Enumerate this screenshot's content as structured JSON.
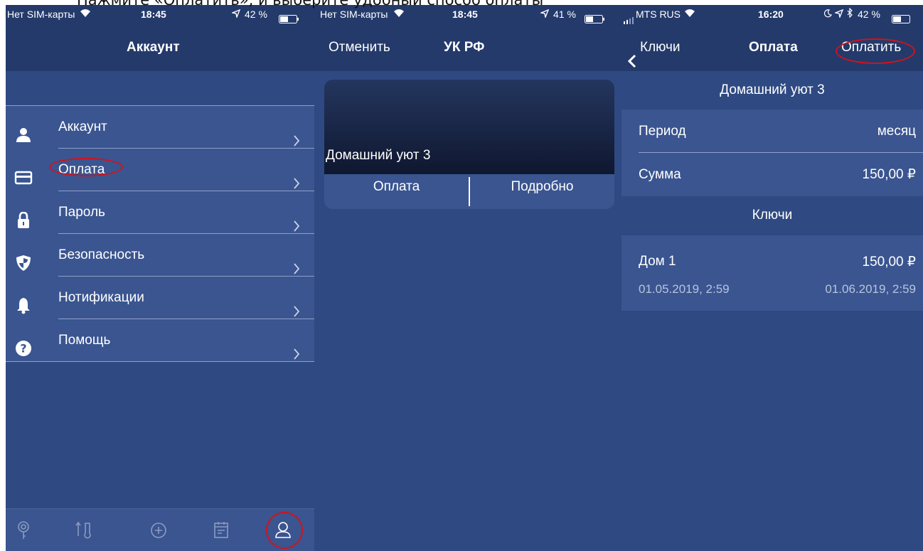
{
  "caption": "Нажмите «Оплатить», и выберите удобный способ оплаты",
  "left_screen": {
    "status": {
      "carrier": "Нет SIM-карты",
      "time": "18:45",
      "battery": "42 %"
    },
    "nav_title": "Аккаунт",
    "menu": [
      {
        "label": "Аккаунт",
        "icon": "person-icon"
      },
      {
        "label": "Оплата",
        "icon": "card-icon"
      },
      {
        "label": "Пароль",
        "icon": "lock-icon"
      },
      {
        "label": "Безопасность",
        "icon": "shield-icon"
      },
      {
        "label": "Нотификации",
        "icon": "bell-icon"
      },
      {
        "label": "Помощь",
        "icon": "help-icon"
      }
    ],
    "tabs": [
      "key-icon",
      "thermometer-icon",
      "add-icon",
      "calendar-icon",
      "profile-icon"
    ]
  },
  "middle_screen": {
    "status": {
      "carrier": "Нет SIM-карты",
      "time": "18:45",
      "battery": "41 %"
    },
    "cancel": "Отменить",
    "nav_title": "УК РФ",
    "card": {
      "title": "Домашний уют 3",
      "pay": "Оплата",
      "details": "Подробно"
    }
  },
  "right_screen": {
    "status": {
      "carrier": "MTS RUS",
      "time": "16:20",
      "battery": "42 %"
    },
    "back": "Ключи",
    "nav_title": "Оплата",
    "pay_action": "Оплатить",
    "header": "Домашний уют 3",
    "period_label": "Период",
    "period_value": "месяц",
    "sum_label": "Сумма",
    "sum_value": "150,00 ₽",
    "keys_header": "Ключи",
    "key": {
      "name": "Дом 1",
      "price": "150,00 ₽",
      "from": "01.05.2019, 2:59",
      "to": "01.06.2019, 2:59"
    }
  },
  "colors": {
    "background": "#2f4a82",
    "bar": "#243a6b",
    "highlight": "#d3121b"
  }
}
